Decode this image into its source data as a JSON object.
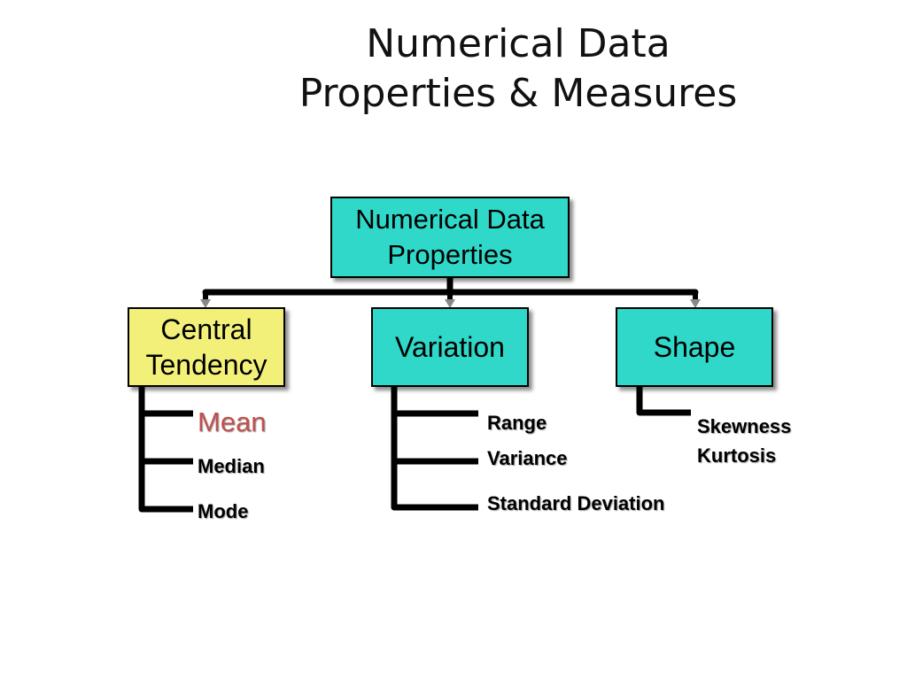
{
  "title": {
    "line1": "Numerical Data",
    "line2": "Properties & Measures"
  },
  "root": {
    "line1": "Numerical Data",
    "line2": "Properties"
  },
  "categories": [
    {
      "line1": "Central",
      "line2": "Tendency",
      "color": "#f3f07a"
    },
    {
      "line1": "Variation",
      "color": "#2fd8c8"
    },
    {
      "line1": "Shape",
      "color": "#2fd8c8"
    }
  ],
  "central_tendency_items": [
    {
      "label": "Mean",
      "color": "#c0504d"
    },
    {
      "label": "Median"
    },
    {
      "label": "Mode"
    }
  ],
  "variation_items": [
    {
      "label": "Range"
    },
    {
      "label": "Variance"
    },
    {
      "label": "Standard Deviation"
    }
  ],
  "shape_items": [
    {
      "label": "Skewness"
    },
    {
      "label": "Kurtosis"
    }
  ]
}
